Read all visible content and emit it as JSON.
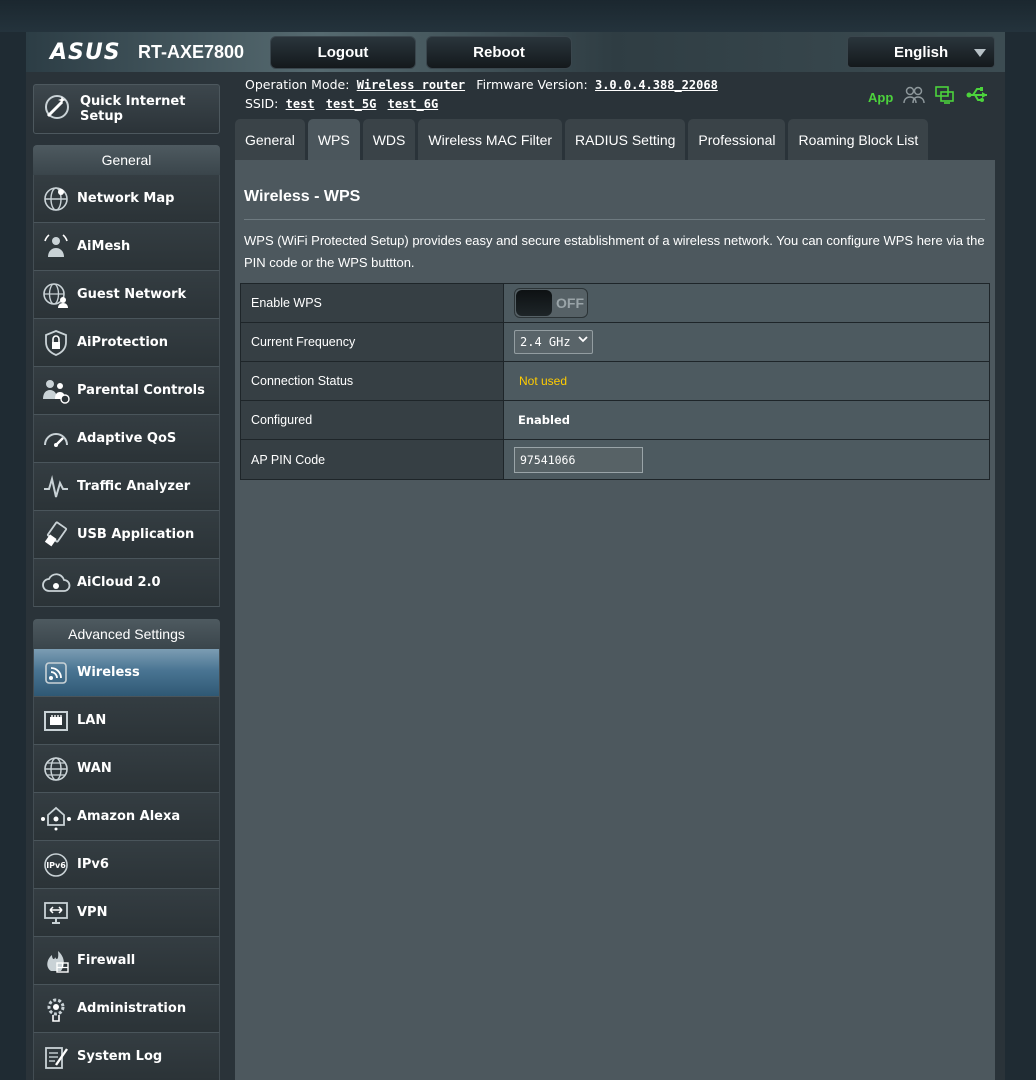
{
  "header": {
    "brand": "ASUS",
    "model": "RT-AXE7800",
    "logout_label": "Logout",
    "reboot_label": "Reboot",
    "language": "English"
  },
  "info": {
    "operation_mode_label": "Operation Mode:",
    "operation_mode": "Wireless router",
    "firmware_label": "Firmware Version:",
    "firmware": "3.0.0.4.388_22068",
    "ssid_label": "SSID:",
    "ssids": [
      "test",
      "test_5G",
      "test_6G"
    ],
    "app_label": "App"
  },
  "sidebar": {
    "quick_setup_label": "Quick Internet Setup",
    "general_head": "General",
    "general_items": [
      {
        "label": "Network Map",
        "icon": "globe-icon"
      },
      {
        "label": "AiMesh",
        "icon": "aimesh-icon"
      },
      {
        "label": "Guest Network",
        "icon": "guest-network-icon"
      },
      {
        "label": "AiProtection",
        "icon": "shield-lock-icon"
      },
      {
        "label": "Parental Controls",
        "icon": "parental-icon"
      },
      {
        "label": "Adaptive QoS",
        "icon": "gauge-icon"
      },
      {
        "label": "Traffic Analyzer",
        "icon": "traffic-icon"
      },
      {
        "label": "USB Application",
        "icon": "usb-icon"
      },
      {
        "label": "AiCloud 2.0",
        "icon": "cloud-icon"
      }
    ],
    "advanced_head": "Advanced Settings",
    "advanced_items": [
      {
        "label": "Wireless",
        "icon": "wireless-icon",
        "active": true
      },
      {
        "label": "LAN",
        "icon": "lan-icon"
      },
      {
        "label": "WAN",
        "icon": "wan-globe-icon"
      },
      {
        "label": "Amazon Alexa",
        "icon": "alexa-icon"
      },
      {
        "label": "IPv6",
        "icon": "ipv6-icon"
      },
      {
        "label": "VPN",
        "icon": "vpn-icon"
      },
      {
        "label": "Firewall",
        "icon": "firewall-icon"
      },
      {
        "label": "Administration",
        "icon": "gear-icon"
      },
      {
        "label": "System Log",
        "icon": "log-icon"
      }
    ]
  },
  "tabs": [
    "General",
    "WPS",
    "WDS",
    "Wireless MAC Filter",
    "RADIUS Setting",
    "Professional",
    "Roaming Block List"
  ],
  "active_tab": "WPS",
  "main": {
    "title": "Wireless - WPS",
    "description": "WPS (WiFi Protected Setup) provides easy and secure establishment of a wireless network. You can configure WPS here via the PIN code or the WPS buttton.",
    "rows": {
      "enable_wps_label": "Enable WPS",
      "enable_wps_state": "OFF",
      "frequency_label": "Current Frequency",
      "frequency_value": "2.4 GHz",
      "connection_label": "Connection Status",
      "connection_value": "Not used",
      "configured_label": "Configured",
      "configured_value": "Enabled",
      "pin_label": "AP PIN Code",
      "pin_value": "97541066"
    }
  },
  "colors": {
    "status_yellow": "#ffcc00",
    "app_green": "#4cd33c",
    "active_blue": "#4a7593"
  }
}
